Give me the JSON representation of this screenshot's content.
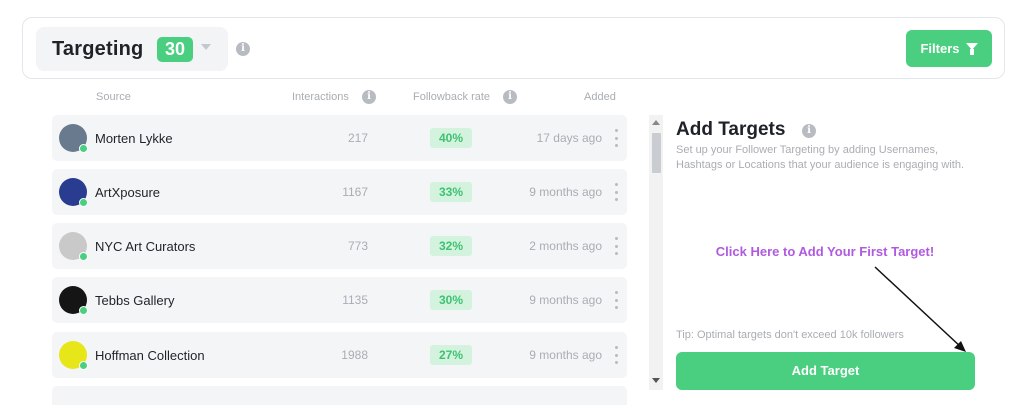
{
  "header": {
    "title": "Targeting",
    "count": "30",
    "filters_label": "Filters",
    "filter_icon": "filter-icon",
    "info_icon": "info-icon"
  },
  "table": {
    "columns": {
      "source": "Source",
      "interactions": "Interactions",
      "followback": "Followback rate",
      "added": "Added"
    },
    "rows": [
      {
        "name": "Morten Lykke",
        "interactions": "217",
        "rate": "40%",
        "added": "17 days ago",
        "avatar_color": "#6a7a8e"
      },
      {
        "name": "ArtXposure",
        "interactions": "1167",
        "rate": "33%",
        "added": "9 months ago",
        "avatar_color": "#2a3c8f"
      },
      {
        "name": "NYC Art Curators",
        "interactions": "773",
        "rate": "32%",
        "added": "2 months ago",
        "avatar_color": "#c9c9c9"
      },
      {
        "name": "Tebbs Gallery",
        "interactions": "1135",
        "rate": "30%",
        "added": "9 months ago",
        "avatar_color": "#151515"
      },
      {
        "name": "Hoffman Collection",
        "interactions": "1988",
        "rate": "27%",
        "added": "9 months ago",
        "avatar_color": "#e6e619"
      }
    ]
  },
  "panel": {
    "title": "Add Targets",
    "description": "Set up your Follower Targeting by adding Usernames, Hashtags or Locations that your audience is engaging with.",
    "cta": "Click Here to Add Your First Target!",
    "tip": "Tip: Optimal targets don't exceed 10k followers",
    "add_label": "Add Target"
  },
  "colors": {
    "accent": "#49cf7f",
    "cta": "#b05ae0",
    "muted": "#a9adb3"
  }
}
